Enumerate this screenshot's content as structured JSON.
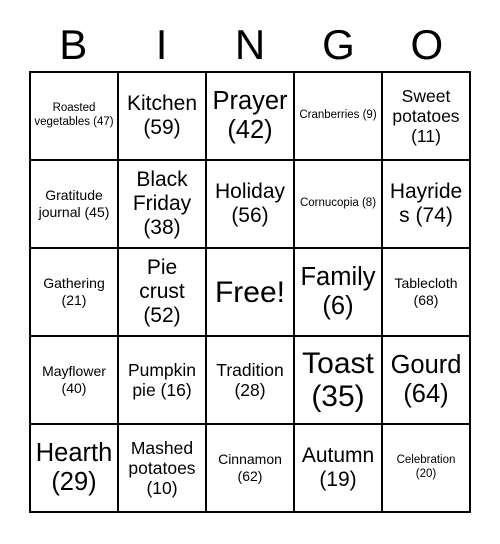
{
  "card": {
    "title_letters": [
      "B",
      "I",
      "N",
      "G",
      "O"
    ],
    "free_space_label": "Free!",
    "columns": [
      {
        "letter": "B",
        "cells": [
          {
            "label": "Roasted vegetables",
            "number": "47",
            "text": "Roasted vegetables (47)",
            "size": "xs"
          },
          {
            "label": "Gratitude journal",
            "number": "45",
            "text": "Gratitude journal (45)",
            "size": "s"
          },
          {
            "label": "Gathering",
            "number": "21",
            "text": "Gathering (21)",
            "size": "s"
          },
          {
            "label": "Mayflower",
            "number": "40",
            "text": "Mayflower (40)",
            "size": "s"
          },
          {
            "label": "Hearth",
            "number": "29",
            "text": "Hearth (29)",
            "size": "xl"
          }
        ]
      },
      {
        "letter": "I",
        "cells": [
          {
            "label": "Kitchen",
            "number": "59",
            "text": "Kitchen (59)",
            "size": "l"
          },
          {
            "label": "Black Friday",
            "number": "38",
            "text": "Black Friday (38)",
            "size": "l"
          },
          {
            "label": "Pie crust",
            "number": "52",
            "text": "Pie crust (52)",
            "size": "l"
          },
          {
            "label": "Pumpkin pie",
            "number": "16",
            "text": "Pumpkin pie (16)",
            "size": "m"
          },
          {
            "label": "Mashed potatoes",
            "number": "10",
            "text": "Mashed potatoes (10)",
            "size": "m"
          }
        ]
      },
      {
        "letter": "N",
        "cells": [
          {
            "label": "Prayer",
            "number": "42",
            "text": "Prayer (42)",
            "size": "xl"
          },
          {
            "label": "Holiday",
            "number": "56",
            "text": "Holiday (56)",
            "size": "l"
          },
          {
            "label": "Free!",
            "number": "",
            "text": "Free!",
            "size": "xxl"
          },
          {
            "label": "Tradition",
            "number": "28",
            "text": "Tradition (28)",
            "size": "m"
          },
          {
            "label": "Cinnamon",
            "number": "62",
            "text": "Cinnamon (62)",
            "size": "s"
          }
        ]
      },
      {
        "letter": "G",
        "cells": [
          {
            "label": "Cranberries",
            "number": "9",
            "text": "Cranberries (9)",
            "size": "xs"
          },
          {
            "label": "Cornucopia",
            "number": "8",
            "text": "Cornucopia (8)",
            "size": "xs"
          },
          {
            "label": "Family",
            "number": "6",
            "text": "Family (6)",
            "size": "xl"
          },
          {
            "label": "Toast",
            "number": "35",
            "text": "Toast (35)",
            "size": "xxl"
          },
          {
            "label": "Autumn",
            "number": "19",
            "text": "Autumn (19)",
            "size": "l"
          }
        ]
      },
      {
        "letter": "O",
        "cells": [
          {
            "label": "Sweet potatoes",
            "number": "11",
            "text": "Sweet potatoes (11)",
            "size": "m"
          },
          {
            "label": "Hayrides",
            "number": "74",
            "text": "Hayrides (74)",
            "size": "l"
          },
          {
            "label": "Tablecloth",
            "number": "68",
            "text": "Tablecloth (68)",
            "size": "s"
          },
          {
            "label": "Gourd",
            "number": "64",
            "text": "Gourd (64)",
            "size": "xl"
          },
          {
            "label": "Celebration",
            "number": "20",
            "text": "Celebration (20)",
            "size": "xs"
          }
        ]
      }
    ],
    "rows": [
      [
        "Roasted vegetables (47)",
        "Kitchen (59)",
        "Prayer (42)",
        "Cranberries (9)",
        "Sweet potatoes (11)"
      ],
      [
        "Gratitude journal (45)",
        "Black Friday (38)",
        "Holiday (56)",
        "Cornucopia (8)",
        "Hayrides (74)"
      ],
      [
        "Gathering (21)",
        "Pie crust (52)",
        "Free!",
        "Family (6)",
        "Tablecloth (68)"
      ],
      [
        "Mayflower (40)",
        "Pumpkin pie (16)",
        "Tradition (28)",
        "Toast (35)",
        "Gourd (64)"
      ],
      [
        "Hearth (29)",
        "Mashed potatoes (10)",
        "Cinnamon (62)",
        "Autumn (19)",
        "Celebration (20)"
      ]
    ],
    "colors": {
      "background": "#ffffff",
      "text": "#000000",
      "border": "#000000"
    }
  }
}
